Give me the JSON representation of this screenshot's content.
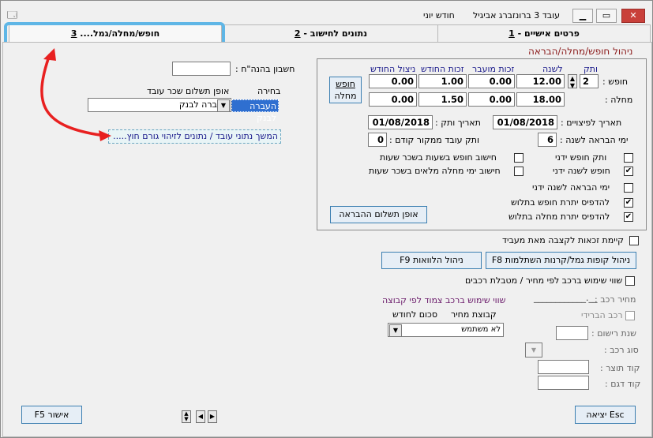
{
  "window": {
    "title": "עובד 3 ברונזברג אביגיל",
    "month": "חודש יוני",
    "app_icon": "form-icon",
    "controls": {
      "minimize": "▁",
      "restore": "▭",
      "close": "✕"
    }
  },
  "tabs": [
    {
      "num": "1",
      "label": "פרטים אישיים - "
    },
    {
      "num": "2",
      "label": "נתונים לחישוב - "
    },
    {
      "num": "3",
      "label": "חופש/מחלה/גמל.... "
    }
  ],
  "section_title": "ניהול חופש/מחלה/הבראה",
  "table": {
    "headers": {
      "seniority": "ותק",
      "per_year": "לשנה",
      "transferred": "זכות מועבר",
      "monthly_right": "זכות החודש",
      "monthly_usage": "ניצול החודש"
    },
    "vacation": {
      "label": "חופש :",
      "seniority": "2",
      "per_year": "12.00",
      "transferred": "0.00",
      "monthly_right": "1.00",
      "monthly_usage": "0.00"
    },
    "sick": {
      "label": "מחלה :",
      "per_year": "18.00",
      "transferred": "0.00",
      "monthly_right": "1.50",
      "monthly_usage": "0.00"
    },
    "vacation_sick_button": [
      "חופש",
      "מחלה"
    ]
  },
  "dates": {
    "severance_label": "תאריך לפיצויים :",
    "severance_value": "01/08/2018",
    "seniority_date_label": "תאריך ותק :",
    "seniority_date_value": "01/08/2018",
    "recovery_days_label": "ימי הבראה לשנה :",
    "recovery_days_value": "6",
    "prev_seniority_label": "ותק עובד ממקור קודם :",
    "prev_seniority_value": "0"
  },
  "checks": {
    "manual_vacation_seniority": {
      "label": "ותק חופש ידני",
      "checked": false
    },
    "manual_vacation_year": {
      "label": "חופש לשנה ידני",
      "checked": true
    },
    "manual_recovery_year": {
      "label": "ימי הבראה לשנה ידני",
      "checked": false
    },
    "print_vacation_balance": {
      "label": "להדפיס יתרת חופש בתלוש",
      "checked": true
    },
    "print_sick_balance": {
      "label": "להדפיס יתרת מחלה בתלוש",
      "checked": true
    },
    "vacation_hours_calc": {
      "label": "חישוב חופש בשעות בשכר שעות",
      "checked": false
    },
    "full_sick_days_calc": {
      "label": "חישוב ימי מחלה מלאים בשכר שעות",
      "checked": false
    }
  },
  "recovery_payment_button": "אופן תשלום ההבראה",
  "right_panel": {
    "bank_account_label": "חשבון בהנה\"ח :",
    "bank_account_value": "",
    "payment_method_header": "אופן תשלום שכר עובד",
    "choice_header": "בחירה",
    "payment_method_value": "העברה לבנק",
    "choice_value": "העברה לבנק",
    "continue_link": "המשך נתוני עובד / נתונים לזיהוי גורם חוץ....."
  },
  "pension_check": {
    "label": "קיימת זכאות לקצבה מאת מעביד",
    "checked": false
  },
  "buttons": {
    "f8": "F8 ניהול קופות גמל/קרנות השתלמות",
    "f9": "F9 ניהול הלוואות",
    "escape": "יציאה Esc",
    "f5": "F5 אישור"
  },
  "car": {
    "car_value_check": {
      "label": "שווי שימוש ברכב לפי מחיר / מטבלת רכבים",
      "checked": false
    },
    "price_label": "מחיר רכב :",
    "price_value": "____________.__",
    "hybrid_check": {
      "label": "רכב הברידי",
      "checked": false
    },
    "reg_year_label": "שנת רישום :",
    "car_type_label": "סוג רכב :",
    "maker_code_label": "קוד תוצר :",
    "model_code_label": "קוד דגם :",
    "group_title": "שווי שימוש ברכב צמוד לפי קבוצה",
    "group_price_header": "קבוצת מחיר",
    "monthly_amount_header": "סכום לחודש",
    "group_value": "לא משתמש"
  },
  "nav_icons": [
    "updown-arrows-icon",
    "prev-arrow-icon",
    "next-arrow-icon"
  ]
}
